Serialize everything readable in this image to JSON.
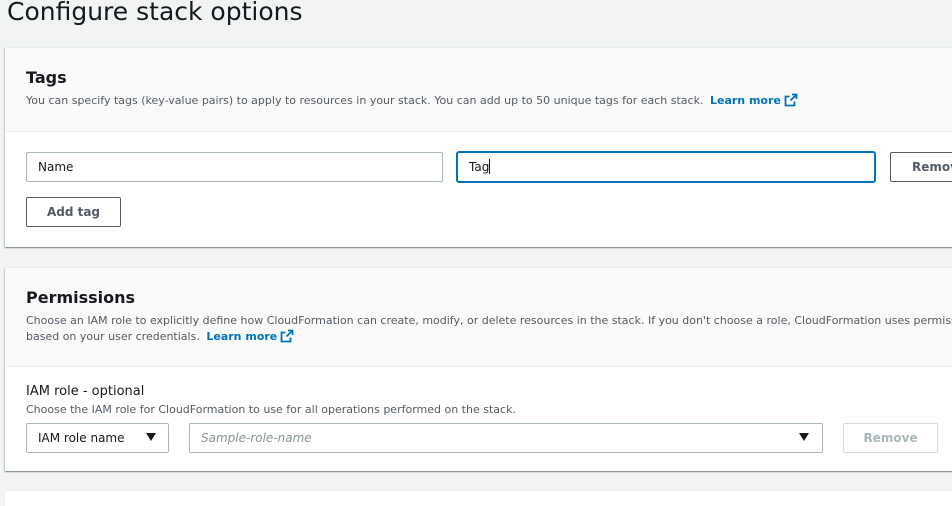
{
  "page": {
    "title": "Configure stack options"
  },
  "tags": {
    "heading": "Tags",
    "description": "You can specify tags (key-value pairs) to apply to resources in your stack. You can add up to 50 unique tags for each stack.",
    "learn_more": "Learn more",
    "key_value": "Name",
    "value_value": "Tag",
    "remove_label": "Remove",
    "add_tag_label": "Add tag"
  },
  "permissions": {
    "heading": "Permissions",
    "description_line1": "Choose an IAM role to explicitly define how CloudFormation can create, modify, or delete resources in the stack. If you don't choose a role, CloudFormation uses permissions",
    "description_line2": "based on your user credentials.",
    "learn_more": "Learn more",
    "iam_role_label": "IAM role - optional",
    "iam_role_sublabel": "Choose the IAM role for CloudFormation to use for all operations performed on the stack.",
    "role_type_selected": "IAM role name",
    "role_placeholder": "Sample-role-name",
    "remove_label": "Remove"
  },
  "icons": {
    "external_link": "external-link-icon",
    "dropdown": "caret-down-icon"
  },
  "colors": {
    "link": "#0073bb",
    "focus": "#0073bb",
    "background": "#f2f3f3"
  }
}
